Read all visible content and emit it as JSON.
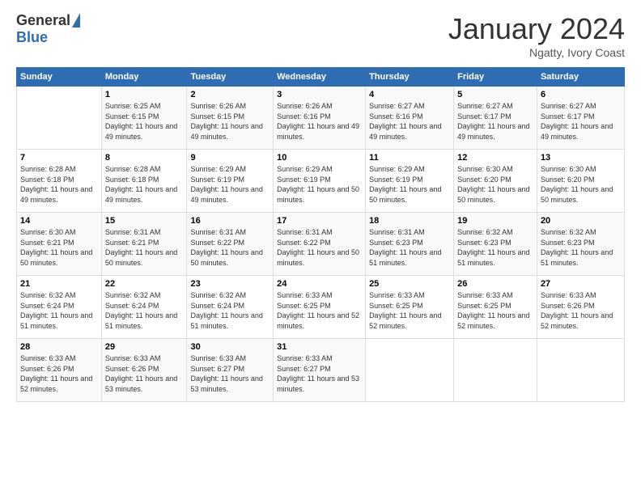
{
  "header": {
    "logo_general": "General",
    "logo_blue": "Blue",
    "month_title": "January 2024",
    "subtitle": "Ngatty, Ivory Coast"
  },
  "weekdays": [
    "Sunday",
    "Monday",
    "Tuesday",
    "Wednesday",
    "Thursday",
    "Friday",
    "Saturday"
  ],
  "weeks": [
    [
      {
        "day": "",
        "sunrise": "",
        "sunset": "",
        "daylight": ""
      },
      {
        "day": "1",
        "sunrise": "Sunrise: 6:25 AM",
        "sunset": "Sunset: 6:15 PM",
        "daylight": "Daylight: 11 hours and 49 minutes."
      },
      {
        "day": "2",
        "sunrise": "Sunrise: 6:26 AM",
        "sunset": "Sunset: 6:15 PM",
        "daylight": "Daylight: 11 hours and 49 minutes."
      },
      {
        "day": "3",
        "sunrise": "Sunrise: 6:26 AM",
        "sunset": "Sunset: 6:16 PM",
        "daylight": "Daylight: 11 hours and 49 minutes."
      },
      {
        "day": "4",
        "sunrise": "Sunrise: 6:27 AM",
        "sunset": "Sunset: 6:16 PM",
        "daylight": "Daylight: 11 hours and 49 minutes."
      },
      {
        "day": "5",
        "sunrise": "Sunrise: 6:27 AM",
        "sunset": "Sunset: 6:17 PM",
        "daylight": "Daylight: 11 hours and 49 minutes."
      },
      {
        "day": "6",
        "sunrise": "Sunrise: 6:27 AM",
        "sunset": "Sunset: 6:17 PM",
        "daylight": "Daylight: 11 hours and 49 minutes."
      }
    ],
    [
      {
        "day": "7",
        "sunrise": "Sunrise: 6:28 AM",
        "sunset": "Sunset: 6:18 PM",
        "daylight": "Daylight: 11 hours and 49 minutes."
      },
      {
        "day": "8",
        "sunrise": "Sunrise: 6:28 AM",
        "sunset": "Sunset: 6:18 PM",
        "daylight": "Daylight: 11 hours and 49 minutes."
      },
      {
        "day": "9",
        "sunrise": "Sunrise: 6:29 AM",
        "sunset": "Sunset: 6:19 PM",
        "daylight": "Daylight: 11 hours and 49 minutes."
      },
      {
        "day": "10",
        "sunrise": "Sunrise: 6:29 AM",
        "sunset": "Sunset: 6:19 PM",
        "daylight": "Daylight: 11 hours and 50 minutes."
      },
      {
        "day": "11",
        "sunrise": "Sunrise: 6:29 AM",
        "sunset": "Sunset: 6:19 PM",
        "daylight": "Daylight: 11 hours and 50 minutes."
      },
      {
        "day": "12",
        "sunrise": "Sunrise: 6:30 AM",
        "sunset": "Sunset: 6:20 PM",
        "daylight": "Daylight: 11 hours and 50 minutes."
      },
      {
        "day": "13",
        "sunrise": "Sunrise: 6:30 AM",
        "sunset": "Sunset: 6:20 PM",
        "daylight": "Daylight: 11 hours and 50 minutes."
      }
    ],
    [
      {
        "day": "14",
        "sunrise": "Sunrise: 6:30 AM",
        "sunset": "Sunset: 6:21 PM",
        "daylight": "Daylight: 11 hours and 50 minutes."
      },
      {
        "day": "15",
        "sunrise": "Sunrise: 6:31 AM",
        "sunset": "Sunset: 6:21 PM",
        "daylight": "Daylight: 11 hours and 50 minutes."
      },
      {
        "day": "16",
        "sunrise": "Sunrise: 6:31 AM",
        "sunset": "Sunset: 6:22 PM",
        "daylight": "Daylight: 11 hours and 50 minutes."
      },
      {
        "day": "17",
        "sunrise": "Sunrise: 6:31 AM",
        "sunset": "Sunset: 6:22 PM",
        "daylight": "Daylight: 11 hours and 50 minutes."
      },
      {
        "day": "18",
        "sunrise": "Sunrise: 6:31 AM",
        "sunset": "Sunset: 6:23 PM",
        "daylight": "Daylight: 11 hours and 51 minutes."
      },
      {
        "day": "19",
        "sunrise": "Sunrise: 6:32 AM",
        "sunset": "Sunset: 6:23 PM",
        "daylight": "Daylight: 11 hours and 51 minutes."
      },
      {
        "day": "20",
        "sunrise": "Sunrise: 6:32 AM",
        "sunset": "Sunset: 6:23 PM",
        "daylight": "Daylight: 11 hours and 51 minutes."
      }
    ],
    [
      {
        "day": "21",
        "sunrise": "Sunrise: 6:32 AM",
        "sunset": "Sunset: 6:24 PM",
        "daylight": "Daylight: 11 hours and 51 minutes."
      },
      {
        "day": "22",
        "sunrise": "Sunrise: 6:32 AM",
        "sunset": "Sunset: 6:24 PM",
        "daylight": "Daylight: 11 hours and 51 minutes."
      },
      {
        "day": "23",
        "sunrise": "Sunrise: 6:32 AM",
        "sunset": "Sunset: 6:24 PM",
        "daylight": "Daylight: 11 hours and 51 minutes."
      },
      {
        "day": "24",
        "sunrise": "Sunrise: 6:33 AM",
        "sunset": "Sunset: 6:25 PM",
        "daylight": "Daylight: 11 hours and 52 minutes."
      },
      {
        "day": "25",
        "sunrise": "Sunrise: 6:33 AM",
        "sunset": "Sunset: 6:25 PM",
        "daylight": "Daylight: 11 hours and 52 minutes."
      },
      {
        "day": "26",
        "sunrise": "Sunrise: 6:33 AM",
        "sunset": "Sunset: 6:25 PM",
        "daylight": "Daylight: 11 hours and 52 minutes."
      },
      {
        "day": "27",
        "sunrise": "Sunrise: 6:33 AM",
        "sunset": "Sunset: 6:26 PM",
        "daylight": "Daylight: 11 hours and 52 minutes."
      }
    ],
    [
      {
        "day": "28",
        "sunrise": "Sunrise: 6:33 AM",
        "sunset": "Sunset: 6:26 PM",
        "daylight": "Daylight: 11 hours and 52 minutes."
      },
      {
        "day": "29",
        "sunrise": "Sunrise: 6:33 AM",
        "sunset": "Sunset: 6:26 PM",
        "daylight": "Daylight: 11 hours and 53 minutes."
      },
      {
        "day": "30",
        "sunrise": "Sunrise: 6:33 AM",
        "sunset": "Sunset: 6:27 PM",
        "daylight": "Daylight: 11 hours and 53 minutes."
      },
      {
        "day": "31",
        "sunrise": "Sunrise: 6:33 AM",
        "sunset": "Sunset: 6:27 PM",
        "daylight": "Daylight: 11 hours and 53 minutes."
      },
      {
        "day": "",
        "sunrise": "",
        "sunset": "",
        "daylight": ""
      },
      {
        "day": "",
        "sunrise": "",
        "sunset": "",
        "daylight": ""
      },
      {
        "day": "",
        "sunrise": "",
        "sunset": "",
        "daylight": ""
      }
    ]
  ]
}
